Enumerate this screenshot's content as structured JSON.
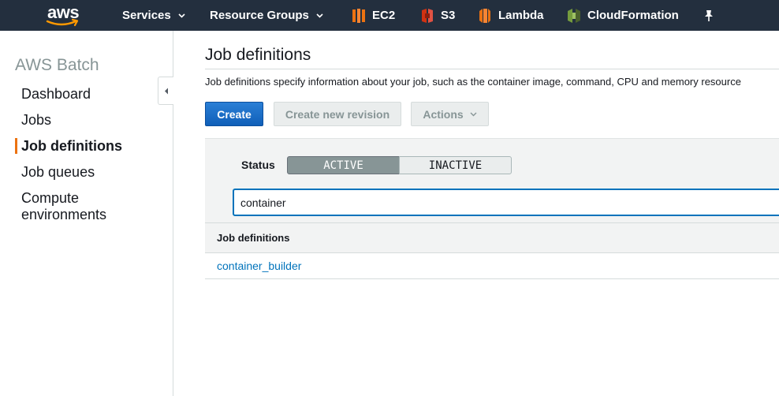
{
  "topbar": {
    "logo_text": "aws",
    "services_label": "Services",
    "resource_groups_label": "Resource Groups",
    "shortcuts": [
      {
        "label": "EC2",
        "icon": "ec2-icon",
        "color": "#ec7211"
      },
      {
        "label": "S3",
        "icon": "s3-icon",
        "color": "#d13212"
      },
      {
        "label": "Lambda",
        "icon": "lambda-icon",
        "color": "#ec7211"
      },
      {
        "label": "CloudFormation",
        "icon": "cloudformation-icon",
        "color": "#7aa116"
      }
    ],
    "pin_icon": "pin-icon"
  },
  "sidebar": {
    "title": "AWS Batch",
    "items": [
      {
        "label": "Dashboard"
      },
      {
        "label": "Jobs"
      },
      {
        "label": "Job definitions",
        "active": true
      },
      {
        "label": "Job queues"
      },
      {
        "label": "Compute environments"
      }
    ],
    "collapse_icon": "chevron-left-icon"
  },
  "main": {
    "title": "Job definitions",
    "description": "Job definitions specify information about your job, such as the container image, command, CPU and memory resource",
    "buttons": {
      "create": "Create",
      "create_revision": "Create new revision",
      "actions": "Actions"
    },
    "filter": {
      "status_label": "Status",
      "options": [
        "ACTIVE",
        "INACTIVE"
      ],
      "selected": "ACTIVE",
      "search_value": "container"
    },
    "table": {
      "columns": [
        "Job definitions"
      ],
      "rows": [
        {
          "name": "container_builder"
        }
      ]
    }
  },
  "colors": {
    "topbar_bg": "#232f3e",
    "accent_orange": "#ec7211",
    "primary_blue": "#1266c4",
    "link_blue": "#0073bb"
  }
}
